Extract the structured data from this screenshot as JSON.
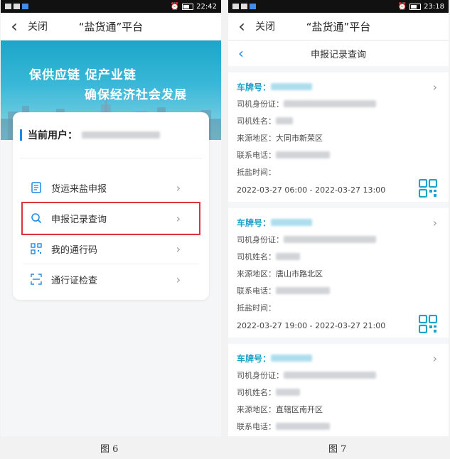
{
  "left": {
    "status": {
      "time": "22:42"
    },
    "nav": {
      "close": "关闭",
      "title": "“盐货通”平台"
    },
    "banner": {
      "line1": "保供应链 促产业链",
      "line2": "确保经济社会发展"
    },
    "user": {
      "label": "当前用户："
    },
    "menu": [
      {
        "label": "货运来盐申报",
        "icon": "document-icon"
      },
      {
        "label": "申报记录查询",
        "icon": "search-icon"
      },
      {
        "label": "我的通行码",
        "icon": "qrcode-icon"
      },
      {
        "label": "通行证检查",
        "icon": "scan-icon"
      }
    ],
    "caption": "图 6"
  },
  "right": {
    "status": {
      "time": "23:18"
    },
    "nav": {
      "close": "关闭",
      "title": "“盐货通”平台"
    },
    "subnav": {
      "title": "申报记录查询"
    },
    "labels": {
      "plate": "车牌号：",
      "id": "司机身份证：",
      "name": "司机姓名：",
      "origin": "来源地区：",
      "phone": "联系电话：",
      "time": "抵盐时间："
    },
    "records": [
      {
        "origin": "大同市新荣区",
        "time": "2022-03-27 06:00 - 2022-03-27 13:00"
      },
      {
        "origin": "唐山市路北区",
        "time": "2022-03-27 19:00 - 2022-03-27 21:00"
      },
      {
        "origin": "直辖区南开区",
        "time": ""
      }
    ],
    "caption": "图 7"
  },
  "colors": {
    "accent": "#1e88e5",
    "plate": "#1aa3c9",
    "highlight": "#d9363e"
  }
}
